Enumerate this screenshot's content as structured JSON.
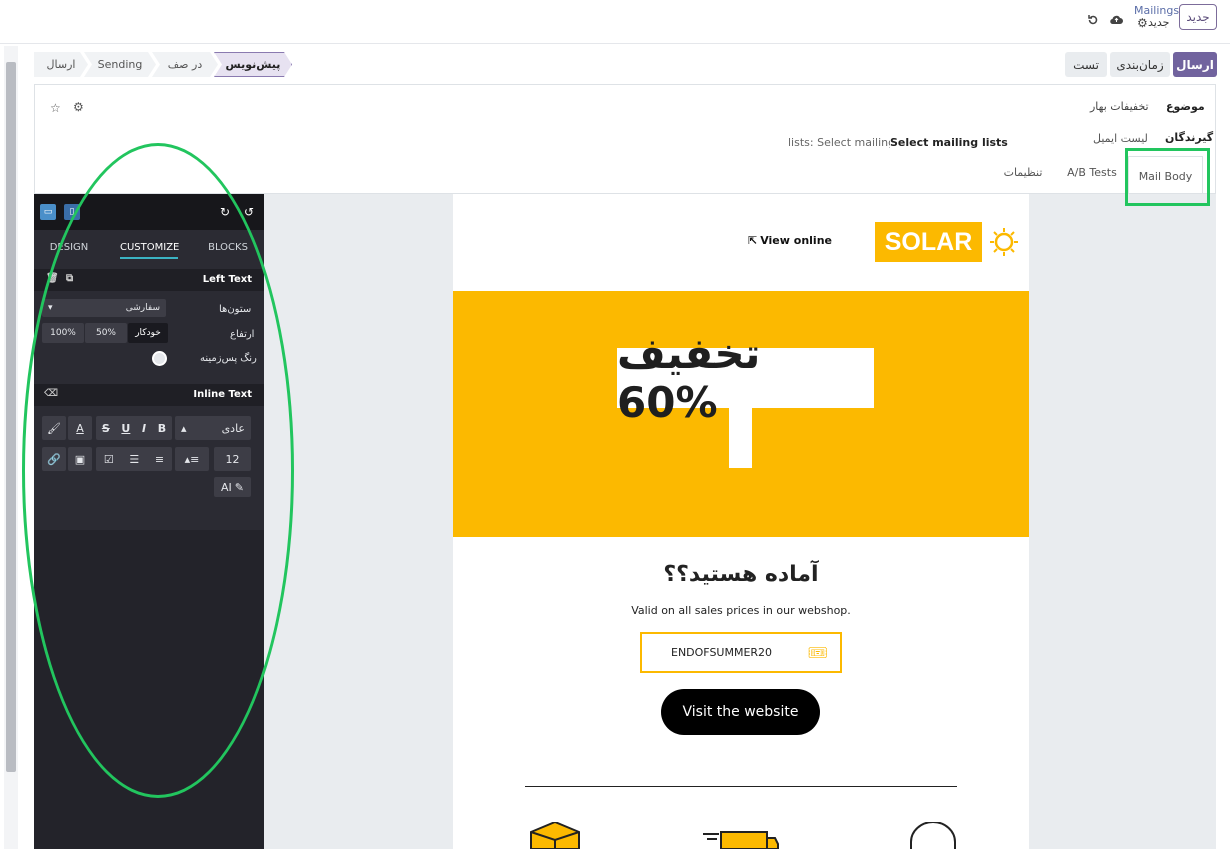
{
  "topbar": {
    "new_label": "جدید",
    "app_title": "Mailings",
    "record_name": "جدید",
    "icons": [
      "gear-icon",
      "cloud-save-icon",
      "discard-icon"
    ]
  },
  "statusbar": {
    "stages": [
      "پیش‌نویس",
      "در صف",
      "Sending",
      "ارسال"
    ],
    "actions": {
      "send": "ارسال",
      "schedule": "زمان‌بندی",
      "test": "تست"
    }
  },
  "form": {
    "subject_label": "موضوع",
    "subject_value": "تخفیفات بهار",
    "recipients_label": "گیرندگان",
    "recipients_value": "لیست ایمیل",
    "mailing_lists_label": "Select mailing lists",
    "mailing_lists_placeholder": "lists: Select mailing lists...",
    "tabs": [
      "Mail Body",
      "A/B Tests",
      "تنظیمات"
    ]
  },
  "editor": {
    "panel_tabs": [
      "BLOCKS",
      "CUSTOMIZE",
      "DESIGN"
    ],
    "active_tab": "CUSTOMIZE",
    "section_left_text": "Left Text",
    "columns_label": "ستون‌ها",
    "columns_value": "سفارشی",
    "height_label": "ارتفاع",
    "height_options": [
      "خودکار",
      "50%",
      "100%"
    ],
    "bg_color_label": "رنگ پس‌زمینه",
    "section_inline_text": "Inline Text",
    "style_select": "عادی",
    "font_size": "12",
    "ai_label": "AI"
  },
  "email": {
    "brand": "SOLAR",
    "view_online": "View online",
    "discount_text": "تخفیف 60%",
    "heading": "آماده هستید؟؟",
    "subtext": "Valid on all sales prices in our webshop.",
    "coupon_code": "ENDOFSUMMER20",
    "cta_label": "Visit the website"
  },
  "colors": {
    "accent": "#71639e",
    "brand_yellow": "#fcb900",
    "panel_bg": "#2b2b33",
    "annotation": "#22c55e"
  }
}
